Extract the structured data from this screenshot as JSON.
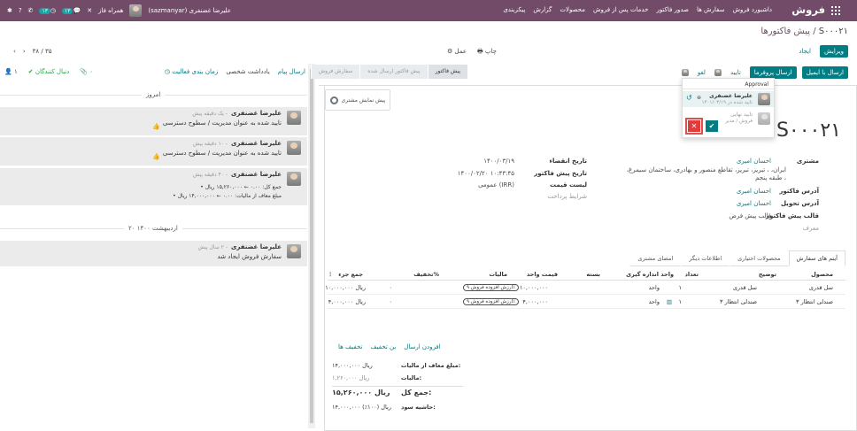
{
  "topbar": {
    "brand": "فروش",
    "menu": [
      "داشبورد فروش",
      "سفارش ها",
      "صدور فاکتور",
      "خدمات پس از فروش",
      "محصولات",
      "گزارش",
      "پیکربندی"
    ],
    "user": "علیرضا غضنفری (sazmanyar)",
    "company": "همراه فاز",
    "badge_activity": "۱۳",
    "badge_messages": "۱۳"
  },
  "title": {
    "parent": "پیش فاکتورها",
    "current": "S۰۰۰۲۱"
  },
  "actions": {
    "edit": "ویرایش",
    "create": "ایجاد",
    "send_email": "ارسال با ایمیل",
    "send_proforma": "ارسال پروفرما",
    "confirm": "تایید",
    "cancel": "لغو"
  },
  "printrow": {
    "print": "چاپ",
    "action": "عمل"
  },
  "pager": {
    "text": "۳۸ / ۳۵"
  },
  "chatter": {
    "send_message": "ارسال پیام",
    "log_note": "یادداشت شخصی",
    "schedule": "زمان بندی فعالیت",
    "attach_count": "۰",
    "follow": "دنبال کنندگان",
    "followers_count": "۱",
    "today": "امروز",
    "date2": "۲۰ اردیبهشت ۱۴۰۰",
    "messages": [
      {
        "who": "علیرضا غضنفری",
        "when": "- یک دقیقه پیش",
        "body": "تایید شده به عنوان مدیریت / سطوح دسترسی"
      },
      {
        "who": "علیرضا غضنفری",
        "when": "- ۱۰ دقیقه پیش",
        "body": "تایید شده به عنوان مدیریت / سطوح دسترسی"
      },
      {
        "who": "علیرضا غضنفری",
        "when": "- ۴۰ دقیقه پیش",
        "body1": "جمع کل: ۰.۰۰ ← ۱۵,۲۶۰,۰۰۰ ریال",
        "body2": "مبلغ معاف از مالیات: ۰.۰۰ ← ۱۴,۰۰۰,۰۰۰ ریال"
      },
      {
        "who": "علیرضا غضنفری",
        "when": "- ۲ سال پیش",
        "body": "سفارش فروش ایجاد شد"
      }
    ]
  },
  "statusbar": [
    "پیش فاکتور",
    "پیش فاکتور ارسال شده",
    "سفارش فروش"
  ],
  "preview": "پیش نمایش مشتری",
  "approval": {
    "header": "Approval",
    "user": "علیرضا غضنفری",
    "date": "تایید شده در ۱۴۰۱/۰۳/۱۹",
    "pending": "تایید نهایی",
    "pending_group": "فروش / مدیر"
  },
  "form": {
    "name": "S۰۰۰۲۱",
    "customer_label": "مشتری",
    "customer": "احسان امیری",
    "customer_address": "ایران، ، تبریز، تبریز، تقاطع منصور و بهادری، ساختمان سیمرغ، طبقه پنجم ،",
    "invoice_addr_label": "آدرس فاکتور",
    "invoice_addr": "احسان امیری",
    "delivery_addr_label": "آدرس تحویل",
    "delivery_addr": "احسان امیری",
    "template_label": "قالب پیش فاکتور",
    "template": "قالب پیش فرض",
    "template_hint": "معرف",
    "expiry_label": "تاریخ انقضاء",
    "expiry": "۱۴۰۰/۰۳/۱۹",
    "quote_date_label": "تاریخ پیش فاکتور",
    "quote_date": "۱۴۰۰/۰۲/۲۰ ۱۰:۴۳:۴۵",
    "pricelist_label": "لیست قیمت",
    "pricelist": "عمومی (IRR)",
    "payment_terms": "شرایط پرداخت"
  },
  "tabs": [
    "آیتم های سفارش",
    "محصولات اختیاری",
    "اطلاعات دیگر",
    "امضای مشتری"
  ],
  "table": {
    "headers": {
      "product": "محصول",
      "desc": "توضیح",
      "qty": "تعداد",
      "uom": "واحد اندازه گیری",
      "package": "بسته",
      "price": "قیمت واحد",
      "taxes": "مالیات",
      "discount": "تخفیف%",
      "subtotal": "جمع جزء"
    },
    "rows": [
      {
        "product": "سل قدری",
        "desc": "سل قدری",
        "qty": "۱",
        "uom": "واحد",
        "price": "۱۰,۰۰۰,۰۰۰",
        "tax": "ارزش افزوده فروش ۹٪",
        "discount": "۰",
        "subtotal": "۱۰,۰۰۰,۰۰۰ ریال"
      },
      {
        "product": "صندلی انتظار ۳",
        "desc": "صندلی انتظار ۳",
        "qty": "۱",
        "uom": "واحد",
        "price": "۴,۰۰۰,۰۰۰",
        "tax": "ارزش افزوده فروش ۹٪",
        "discount": "۰",
        "subtotal": "۴,۰۰۰,۰۰۰ ریال"
      }
    ]
  },
  "footer_links": [
    "افزودن ارسال",
    "بن تخفیف",
    "تخفیف ها"
  ],
  "totals": {
    "untaxed_label": "مبلغ معاف از مالیات:",
    "untaxed": "۱۴,۰۰۰,۰۰۰ ریال",
    "tax_label": "مالیات:",
    "tax": "۱,۲۶۰,۰۰۰ ریال",
    "total_label": "جمع کل:",
    "total": "۱۵,۲۶۰,۰۰۰ ریال",
    "margin_label": "حاشیه سود:",
    "margin": "۱۴,۰۰۰,۰۰۰ ریال (۱۰۰٪)"
  },
  "colors": {
    "brand": "#714b67",
    "primary": "#017e84",
    "danger": "#e23b3b"
  }
}
